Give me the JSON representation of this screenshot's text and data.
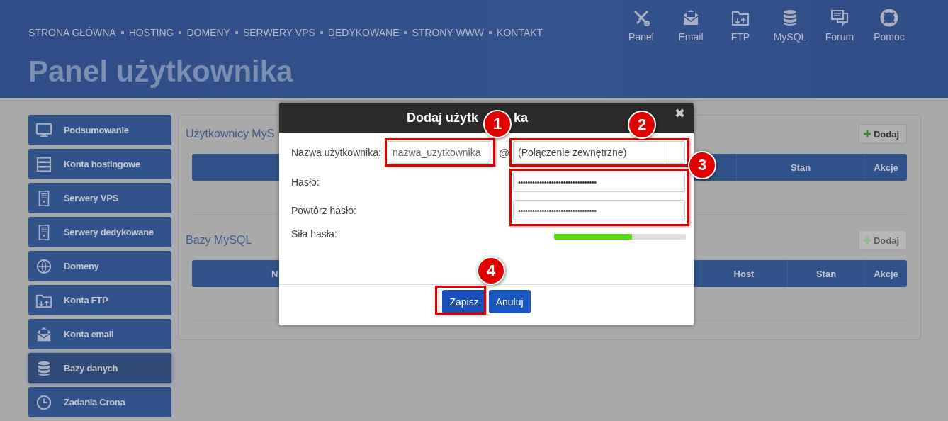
{
  "header": {
    "nav": [
      {
        "label": "STRONA GŁÓWNA"
      },
      {
        "label": "HOSTING"
      },
      {
        "label": "DOMENY"
      },
      {
        "label": "SERWERY VPS"
      },
      {
        "label": "DEDYKOWANE"
      },
      {
        "label": "STRONY WWW"
      },
      {
        "label": "KONTAKT"
      }
    ],
    "shortcuts": [
      {
        "kind": "tools",
        "label": "Panel"
      },
      {
        "kind": "mail",
        "label": "Email"
      },
      {
        "kind": "folder",
        "label": "FTP"
      },
      {
        "kind": "database",
        "label": "MySQL"
      },
      {
        "kind": "chat",
        "label": "Forum"
      },
      {
        "kind": "lifebuoy",
        "label": "Pomoc"
      }
    ],
    "page_title": "Panel użytkownika"
  },
  "sidebar": {
    "items": [
      {
        "kind": "monitor",
        "label": "Podsumowanie",
        "selected": false
      },
      {
        "kind": "rack",
        "label": "Konta hostingowe",
        "selected": false
      },
      {
        "kind": "server",
        "label": "Serwery VPS",
        "selected": false
      },
      {
        "kind": "server",
        "label": "Serwery dedykowane",
        "selected": false
      },
      {
        "kind": "globe",
        "label": "Domeny",
        "selected": false
      },
      {
        "kind": "folder",
        "label": "Konta FTP",
        "selected": false
      },
      {
        "kind": "mail",
        "label": "Konta email",
        "selected": false
      },
      {
        "kind": "database",
        "label": "Bazy danych",
        "selected": true
      },
      {
        "kind": "clock",
        "label": "Zadania Crona",
        "selected": false
      }
    ]
  },
  "sections": [
    {
      "title": "Użytkownicy MyS",
      "add_button": {
        "label": "Dodaj",
        "disabled": false
      },
      "columns": [
        {
          "kind": "spacer"
        },
        {
          "kind": "cell",
          "label": "Stan"
        },
        {
          "kind": "cell",
          "label": "Akcje"
        }
      ]
    },
    {
      "title": "Bazy MySQL",
      "add_button": {
        "label": "Dodaj",
        "disabled": true
      },
      "columns": [
        {
          "kind": "partial",
          "label": "N"
        },
        {
          "kind": "spacer"
        },
        {
          "kind": "cell",
          "label": "Host"
        },
        {
          "kind": "cell",
          "label": "Stan"
        },
        {
          "kind": "cell",
          "label": "Akcje"
        }
      ]
    }
  ],
  "dialog": {
    "title_visible_parts": [
      "Dodaj użytk",
      "ka"
    ],
    "close": "✖",
    "username": {
      "label": "Nazwa użytkownika:",
      "placeholder": "nazwa_uzytkownika",
      "at": "@",
      "host_value": "(Połączenie zewnętrzne)"
    },
    "password": {
      "label": "Hasło:",
      "value": "•••••••••••••••••••••••••••••••••"
    },
    "repeat": {
      "label": "Powtórz hasło:",
      "value": "•••••••••••••••••••••••••••••••••"
    },
    "strength": {
      "label": "Siła hasła:",
      "level": 0.59
    },
    "buttons": [
      {
        "label": "Zapisz",
        "kind": "primary"
      },
      {
        "label": "Anuluj",
        "kind": "secondary"
      }
    ]
  },
  "annotations": [
    {
      "number": "1"
    },
    {
      "number": "2"
    },
    {
      "number": "3"
    },
    {
      "number": "4"
    }
  ]
}
